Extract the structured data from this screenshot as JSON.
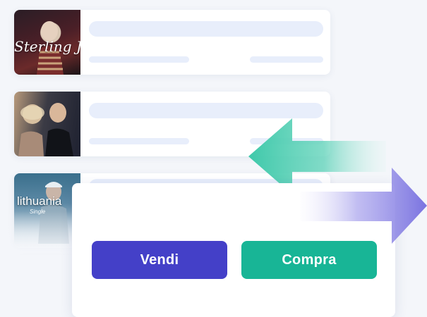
{
  "listings": [
    {
      "id": "item-1",
      "thumb_text": "Sterling Jo",
      "thumb_sub": ""
    },
    {
      "id": "item-2",
      "thumb_text": "",
      "thumb_sub": ""
    },
    {
      "id": "item-3",
      "thumb_text": "lithuania",
      "thumb_sub": "Single"
    }
  ],
  "actions": {
    "sell_label": "Vendi",
    "buy_label": "Compra"
  },
  "icons": {
    "left_arrow": "arrow-left-icon",
    "right_arrow": "arrow-right-icon"
  },
  "colors": {
    "sell": "#4440c8",
    "buy": "#18b596",
    "arrow_left": "#3fc9aa",
    "arrow_right": "#7a73e0"
  }
}
